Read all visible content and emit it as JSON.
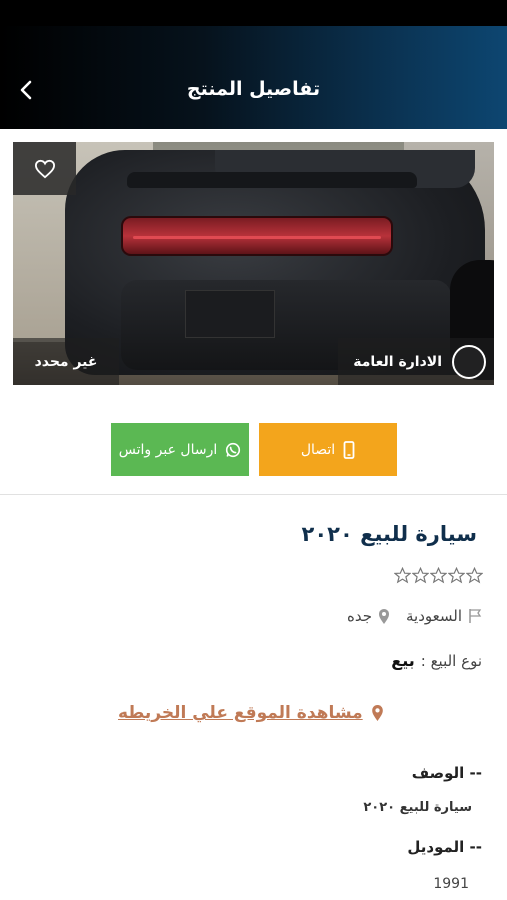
{
  "header": {
    "title": "تفاصيل المنتج"
  },
  "image": {
    "price": "غير محدد",
    "owner": "الادارة العامة"
  },
  "actions": {
    "call_label": "اتصال",
    "whatsapp_label": "ارسال عبر واتس"
  },
  "product": {
    "title": "سيارة للبيع ٢٠٢٠",
    "rating": 0,
    "rating_max": 5,
    "country": "السعودية",
    "city": "جده",
    "sale_type_label": "نوع البيع :",
    "sale_type_value": "بيع",
    "map_link": "مشاهدة  الموقع علي الخريطه"
  },
  "details": {
    "description_heading": "-- الوصف",
    "description_text": "سيارة للبيع ٢٠٢٠",
    "model_heading": "-- الموديل",
    "model_value": "1991"
  },
  "colors": {
    "call": "#f3a51c",
    "whatsapp": "#5bb853",
    "title": "#102f4c",
    "map_link": "#c07a56"
  }
}
